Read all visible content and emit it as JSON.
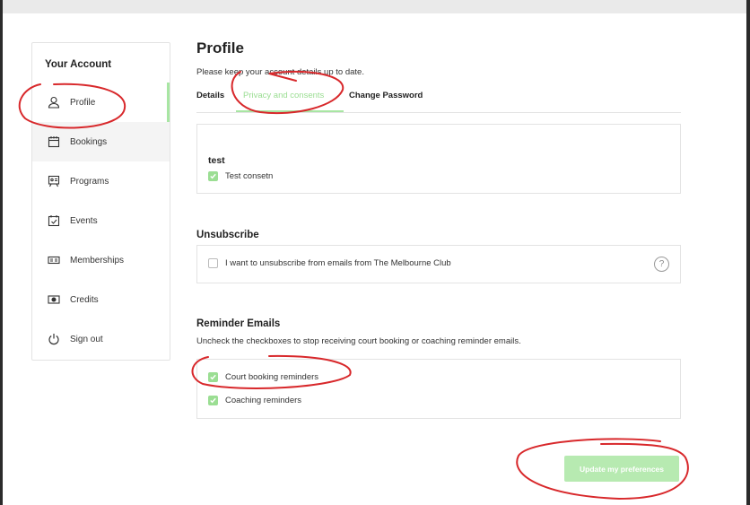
{
  "sidebar": {
    "title": "Your Account",
    "items": [
      {
        "label": "Profile",
        "icon": "user-icon"
      },
      {
        "label": "Bookings",
        "icon": "calendar-icon"
      },
      {
        "label": "Programs",
        "icon": "presentation-icon"
      },
      {
        "label": "Events",
        "icon": "calendar-check-icon"
      },
      {
        "label": "Memberships",
        "icon": "card-icon"
      },
      {
        "label": "Credits",
        "icon": "credit-icon"
      },
      {
        "label": "Sign out",
        "icon": "power-icon"
      }
    ]
  },
  "main": {
    "title": "Profile",
    "subtitle": "Please keep your account details up to date.",
    "tabs": [
      {
        "label": "Details"
      },
      {
        "label": "Privacy and consents",
        "active": true
      },
      {
        "label": "Change Password"
      }
    ]
  },
  "consents": {
    "group_title": "test",
    "items": [
      {
        "label": "Test consetn",
        "checked": true
      }
    ]
  },
  "unsubscribe": {
    "title": "Unsubscribe",
    "label": "I want to unsubscribe from emails from The Melbourne Club",
    "checked": false,
    "help": "?"
  },
  "reminders": {
    "title": "Reminder Emails",
    "subtitle": "Uncheck the checkboxes to stop receiving court booking or coaching reminder emails.",
    "items": [
      {
        "label": "Court booking reminders",
        "checked": true
      },
      {
        "label": "Coaching reminders",
        "checked": true
      }
    ]
  },
  "actions": {
    "update_label": "Update my preferences"
  },
  "colors": {
    "accent": "#9bde93",
    "annotation": "#d8282b"
  }
}
